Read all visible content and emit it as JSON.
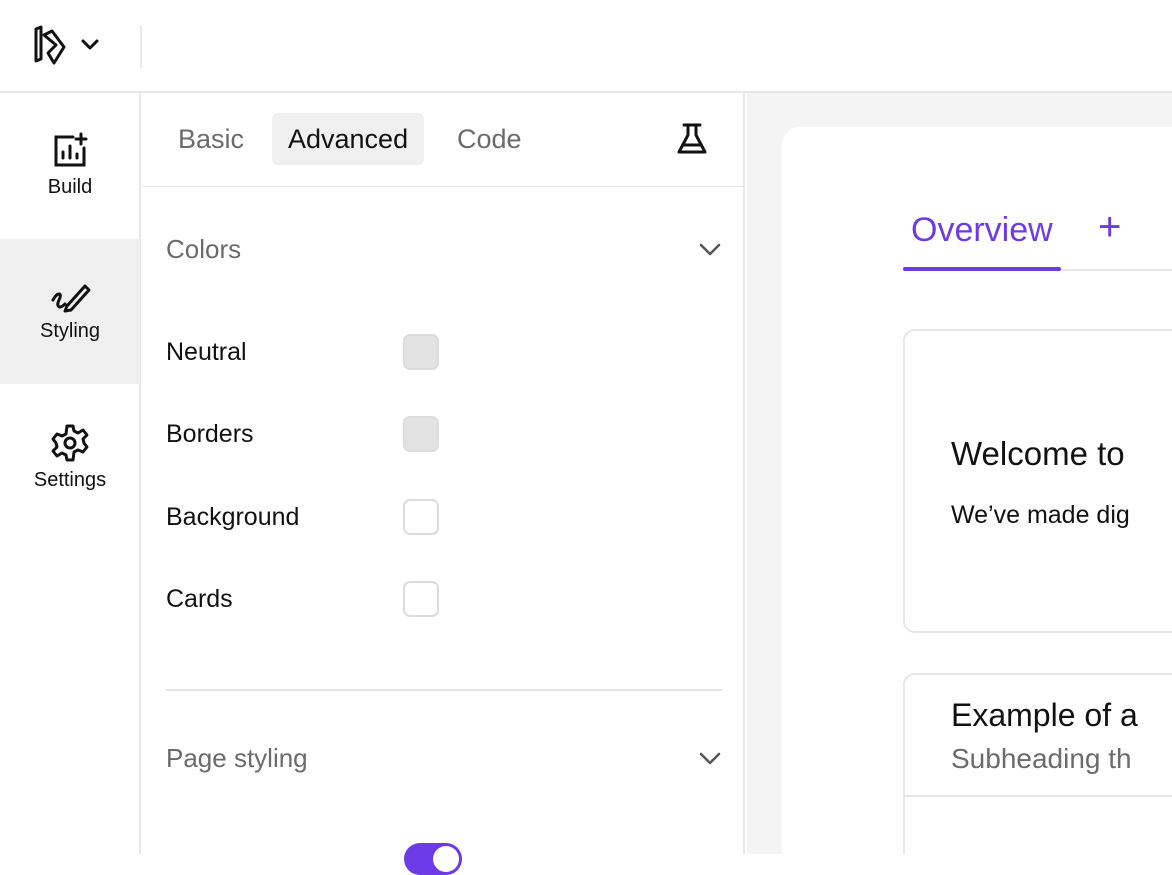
{
  "rail": {
    "items": [
      {
        "label": "Build",
        "icon": "chart-add-icon"
      },
      {
        "label": "Styling",
        "icon": "brush-icon"
      },
      {
        "label": "Settings",
        "icon": "gear-icon"
      }
    ]
  },
  "panel": {
    "tabs": [
      {
        "label": "Basic"
      },
      {
        "label": "Advanced"
      },
      {
        "label": "Code"
      }
    ],
    "colors_section": {
      "title": "Colors",
      "rows": [
        {
          "label": "Neutral"
        },
        {
          "label": "Borders"
        },
        {
          "label": "Background"
        },
        {
          "label": "Cards"
        }
      ]
    },
    "page_styling_section": {
      "title": "Page styling"
    }
  },
  "canvas": {
    "tabs": {
      "overview": "Overview",
      "add": "+"
    },
    "card1": {
      "title": "Welcome to",
      "text": "We’ve made dig"
    },
    "card2": {
      "title": "Example of a",
      "subtitle": "Subheading th"
    }
  },
  "colors": {
    "accent": "#6d3ae8"
  }
}
